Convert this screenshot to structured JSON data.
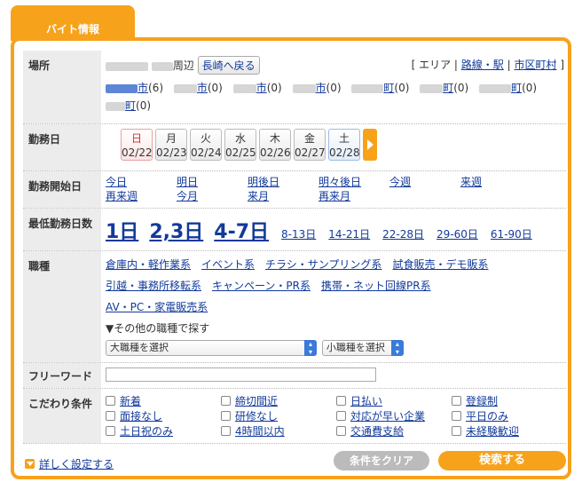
{
  "tab": {
    "label": "バイト情報"
  },
  "location": {
    "label": "場所",
    "nearby_suffix": "周辺",
    "back_button": "長崎へ戻る",
    "links_open": "[ エリア",
    "links": [
      "路線・駅",
      "市区町村"
    ],
    "links_close": "]",
    "areas": [
      {
        "suffix": "市",
        "count": "(6)"
      },
      {
        "suffix": "市",
        "count": "(0)"
      },
      {
        "suffix": "市",
        "count": "(0)"
      },
      {
        "suffix": "市",
        "count": "(0)"
      },
      {
        "suffix": "町",
        "count": "(0)"
      },
      {
        "suffix": "町",
        "count": "(0)"
      },
      {
        "suffix": "町",
        "count": "(0)"
      },
      {
        "suffix": "町",
        "count": "(0)"
      }
    ]
  },
  "workday": {
    "label": "勤務日",
    "days": [
      {
        "dow": "日",
        "date": "02/22"
      },
      {
        "dow": "月",
        "date": "02/23"
      },
      {
        "dow": "火",
        "date": "02/24"
      },
      {
        "dow": "水",
        "date": "02/25"
      },
      {
        "dow": "木",
        "date": "02/26"
      },
      {
        "dow": "金",
        "date": "02/27"
      },
      {
        "dow": "土",
        "date": "02/28"
      }
    ]
  },
  "start": {
    "label": "勤務開始日",
    "options": [
      "今日",
      "明日",
      "明後日",
      "明々後日",
      "今週",
      "来週",
      "再来週",
      "今月",
      "来月",
      "再来月"
    ]
  },
  "min_days": {
    "label": "最低勤務日数",
    "large": [
      "1日",
      "2,3日",
      "4-7日"
    ],
    "small": [
      "8-13日",
      "14-21日",
      "22-28日",
      "29-60日",
      "61-90日"
    ]
  },
  "job": {
    "label": "職種",
    "types": [
      "倉庫内・軽作業系",
      "イベント系",
      "チラシ・サンプリング系",
      "試食販売・デモ販系",
      "引越・事務所移転系",
      "キャンペーン・PR系",
      "携帯・ネット回線PR系",
      "AV・PC・家電販売系"
    ],
    "other_heading": "▼その他の職種で探す",
    "select_major": "大職種を選択",
    "select_minor": "小職種を選択"
  },
  "freeword": {
    "label": "フリーワード",
    "value": ""
  },
  "conditions": {
    "label": "こだわり条件",
    "items": [
      "新着",
      "締切間近",
      "日払い",
      "登録制",
      "面接なし",
      "研修なし",
      "対応が早い企業",
      "平日のみ",
      "土日祝のみ",
      "4時間以内",
      "交通費支給",
      "未経験歓迎"
    ]
  },
  "footer": {
    "detail_link": "詳しく設定する",
    "clear_button": "条件をクリア",
    "search_button": "検索する"
  },
  "colors": {
    "accent": "#f7a21b",
    "link": "#123a9a"
  }
}
